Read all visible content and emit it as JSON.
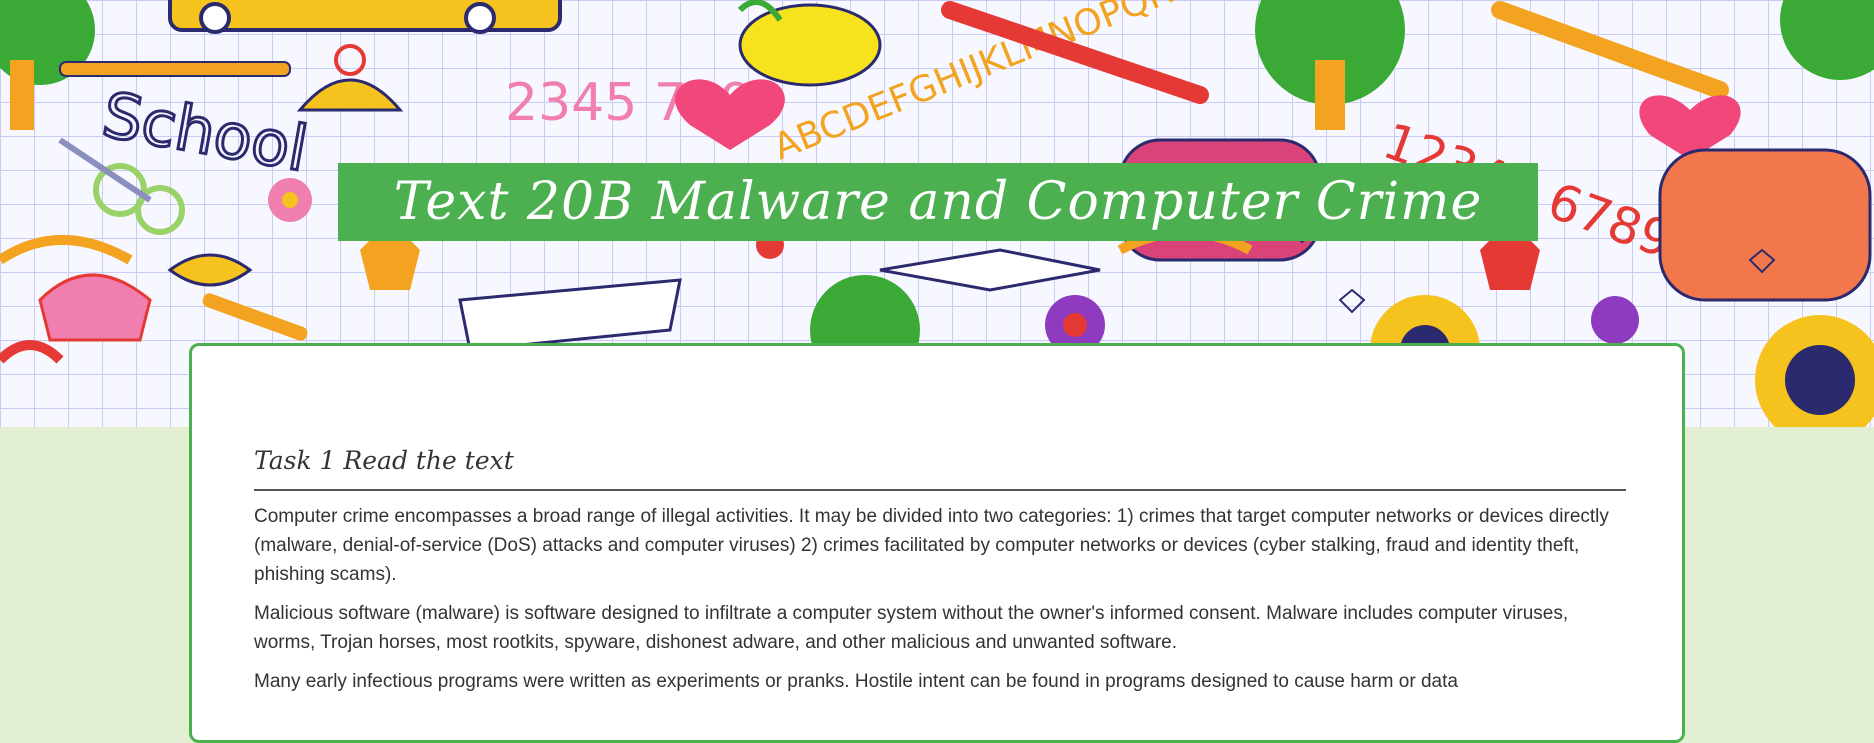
{
  "page": {
    "title": "Text 20B Malware and Computer Crime"
  },
  "colors": {
    "banner": "#4cb050",
    "page_background": "#e3efd2",
    "card_border": "#4cb050"
  },
  "decor": {
    "school_word": "School",
    "letters": "ABCDEFGHIJKLMNOPQRSTUVWXYZ",
    "numbers_left": "2345 7890",
    "numbers_right": "12345 6789"
  },
  "task": {
    "heading": "Task 1 Read the text",
    "paragraphs": [
      "Computer crime encompasses a broad range of illegal activities. It may be divided into two categories: 1) crimes that target computer networks or devices directly (malware, denial-of-service (DoS) attacks and computer viruses) 2) crimes facilitated by computer networks or devices (cyber stalking, fraud and identity theft, phishing scams).",
      "Malicious software (malware) is software designed to infiltrate a computer system without the owner's informed consent. Malware includes computer viruses, worms, Trojan horses, most rootkits, spyware, dishonest adware, and other malicious and unwanted software.",
      "Many early infectious programs were written as experiments or pranks. Hostile intent can be found in programs designed to cause harm or data"
    ]
  }
}
